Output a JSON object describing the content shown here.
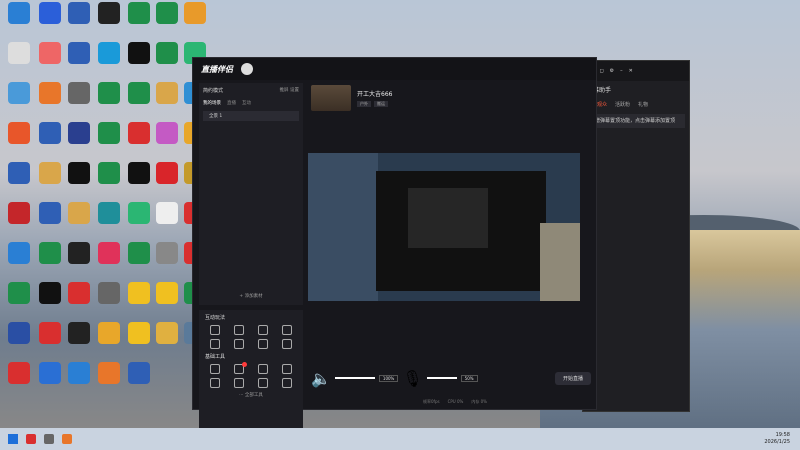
{
  "desktop": {
    "icons": [
      {
        "label": "",
        "color": "#2a7fd4"
      },
      {
        "label": "",
        "color": "#2b5fd9"
      },
      {
        "label": "",
        "color": "#2f5fb5"
      },
      {
        "label": "",
        "color": "#222"
      },
      {
        "label": "",
        "color": "#1f8f4a"
      },
      {
        "label": "",
        "color": "#1f8f4a"
      },
      {
        "label": "",
        "color": "#e89a2a"
      },
      {
        "label": "",
        "color": "#ddd"
      },
      {
        "label": "",
        "color": "#e66"
      },
      {
        "label": "",
        "color": "#2f5fb5"
      },
      {
        "label": "",
        "color": "#1a9ad9"
      },
      {
        "label": "",
        "color": "#111"
      },
      {
        "label": "",
        "color": "#1f8f4a"
      },
      {
        "label": "",
        "color": "#2bb673"
      },
      {
        "label": "",
        "color": "#4a9ad9"
      },
      {
        "label": "",
        "color": "#e8762a"
      },
      {
        "label": "",
        "color": "#666"
      },
      {
        "label": "",
        "color": "#1f8f4a"
      },
      {
        "label": "",
        "color": "#1f8f4a"
      },
      {
        "label": "",
        "color": "#d9a64a"
      },
      {
        "label": "",
        "color": "#2f8fd4"
      },
      {
        "label": "",
        "color": "#e8562a"
      },
      {
        "label": "",
        "color": "#2f5fb5"
      },
      {
        "label": "",
        "color": "#2a3f8f"
      },
      {
        "label": "",
        "color": "#1f8f4a"
      },
      {
        "label": "",
        "color": "#d92f2f"
      },
      {
        "label": "",
        "color": "#c45ac4"
      },
      {
        "label": "",
        "color": "#e8a72a"
      },
      {
        "label": "",
        "color": "#2f5fb5"
      },
      {
        "label": "",
        "color": "#d9a64a"
      },
      {
        "label": "",
        "color": "#111"
      },
      {
        "label": "",
        "color": "#1f8f4a"
      },
      {
        "label": "",
        "color": "#111"
      },
      {
        "label": "",
        "color": "#d9252a"
      },
      {
        "label": "",
        "color": "#c49a2a"
      },
      {
        "label": "",
        "color": "#c4262a"
      },
      {
        "label": "",
        "color": "#2f5fb5"
      },
      {
        "label": "",
        "color": "#d9a64a"
      },
      {
        "label": "",
        "color": "#1f8f9a"
      },
      {
        "label": "",
        "color": "#2bb673"
      },
      {
        "label": "",
        "color": "#eee"
      },
      {
        "label": "",
        "color": "#d92f2f"
      },
      {
        "label": "",
        "color": "#2a7fd4"
      },
      {
        "label": "",
        "color": "#1f8f4a"
      },
      {
        "label": "",
        "color": "#222"
      },
      {
        "label": "",
        "color": "#e0325a"
      },
      {
        "label": "",
        "color": "#1f8f4a"
      },
      {
        "label": "",
        "color": "#888"
      },
      {
        "label": "",
        "color": "#d92f2f"
      },
      {
        "label": "",
        "color": "#1f8f4a"
      },
      {
        "label": "",
        "color": "#111"
      },
      {
        "label": "",
        "color": "#d92f2f"
      },
      {
        "label": "",
        "color": "#666"
      },
      {
        "label": "",
        "color": "#f0c020"
      },
      {
        "label": "",
        "color": "#f0c020"
      },
      {
        "label": "",
        "color": "#1f8f4a"
      },
      {
        "label": "",
        "color": "#2a4fa4"
      },
      {
        "label": "",
        "color": "#d92f2f"
      },
      {
        "label": "",
        "color": "#222"
      },
      {
        "label": "",
        "color": "#e8a72a"
      },
      {
        "label": "",
        "color": "#f0c020"
      },
      {
        "label": "",
        "color": "#e0b040"
      },
      {
        "label": "",
        "color": "#5a7a9a"
      },
      {
        "label": "",
        "color": "#d92f2f"
      },
      {
        "label": "",
        "color": "#2a6fd4"
      },
      {
        "label": "",
        "color": "#2a7fd4"
      },
      {
        "label": "",
        "color": "#e8762a"
      },
      {
        "label": "",
        "color": "#2f5fb5"
      }
    ]
  },
  "main": {
    "app_name": "直播伴侣",
    "scene_label": "简约模式",
    "scene_action_1": "推屏",
    "scene_action_2": "设置",
    "tabs": [
      "我的场景",
      "直播",
      "互动"
    ],
    "scene_item": "全景 1",
    "add_material": "+ 添加素材",
    "interaction_title": "互动玩法",
    "basic_tools_title": "基础工具",
    "more_tools": "··· 全部工具",
    "stream_name": "开工大吉666",
    "tags": [
      "户外",
      "搬运"
    ],
    "volume_pct": "100%",
    "mic_pct": "50%",
    "start_button": "开始直播",
    "status_items": [
      "帧率0fps",
      "CPU 0%",
      "内存 0%"
    ]
  },
  "right_panel": {
    "tabs": [
      "在线观众",
      "活跃粉",
      "礼物"
    ],
    "title": "弹幕助手",
    "card_text": "新增弹幕置顶功能，点击弹幕添加置顶"
  },
  "taskbar": {
    "time": "19:58",
    "date": "2026/1/25"
  }
}
